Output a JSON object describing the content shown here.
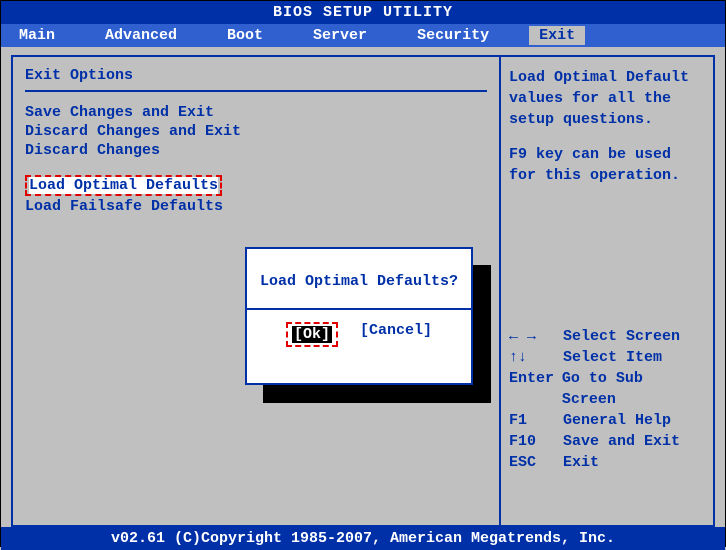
{
  "title": "BIOS SETUP UTILITY",
  "menu": {
    "items": [
      "Main",
      "Advanced",
      "Boot",
      "Server",
      "Security",
      "Exit"
    ],
    "selected_index": 5
  },
  "left_panel": {
    "heading": "Exit Options",
    "options": [
      "Save Changes and Exit",
      "Discard Changes and Exit",
      "Discard Changes",
      "Load Optimal Defaults",
      "Load Failsafe Defaults"
    ],
    "selected_index": 3
  },
  "right_panel": {
    "help_line1": "Load Optimal Default",
    "help_line2": "values for all the",
    "help_line3": "setup questions.",
    "help_line4": "F9 key can be used",
    "help_line5": "for this operation.",
    "keys": [
      {
        "k": "←  →",
        "d": "Select Screen"
      },
      {
        "k": "↑↓",
        "d": "Select Item"
      },
      {
        "k": "Enter",
        "d": "Go to Sub Screen"
      },
      {
        "k": "F1",
        "d": "General Help"
      },
      {
        "k": "F10",
        "d": "Save and Exit"
      },
      {
        "k": "ESC",
        "d": "Exit"
      }
    ]
  },
  "dialog": {
    "message": "Load Optimal Defaults?",
    "ok": "[Ok]",
    "cancel": "[Cancel]"
  },
  "footer": "v02.61 (C)Copyright 1985-2007, American Megatrends, Inc."
}
